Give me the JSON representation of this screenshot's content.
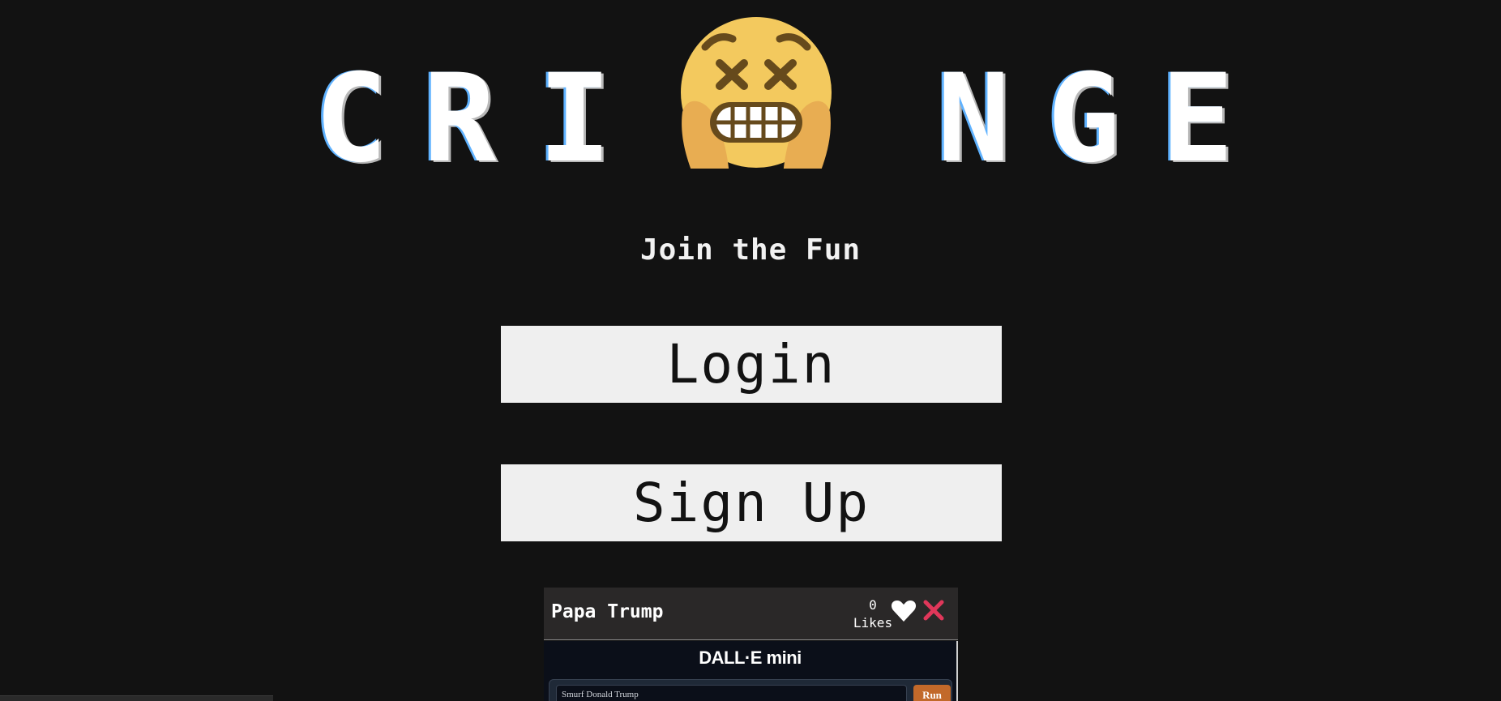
{
  "title": {
    "letters": [
      "C",
      "R",
      "I",
      "N",
      "G",
      "E"
    ],
    "emoji_icon": "face-screaming-grimace-emoji"
  },
  "subtitle": "Join the Fun",
  "buttons": {
    "login": "Login",
    "signup": "Sign Up"
  },
  "post": {
    "title": "Papa Trump",
    "likes_count": "0",
    "likes_label": "Likes",
    "embed": {
      "app_title": "DALL·E mini",
      "prompt_value": "Smurf Donald Trump",
      "run_label": "Run"
    }
  },
  "colors": {
    "background": "#121212",
    "button_bg": "#efefef",
    "close_red": "#e0375a",
    "run_orange": "#c2692a"
  }
}
